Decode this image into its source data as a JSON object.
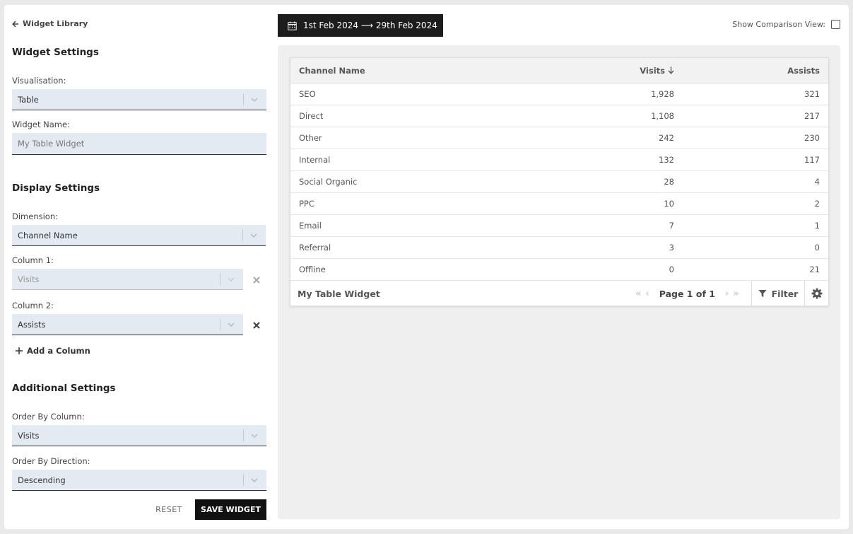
{
  "nav": {
    "back_label": "Widget Library"
  },
  "widget_settings": {
    "title": "Widget Settings",
    "visualisation_label": "Visualisation:",
    "visualisation_value": "Table",
    "name_label": "Widget Name:",
    "name_placeholder": "My Table Widget"
  },
  "display_settings": {
    "title": "Display Settings",
    "dimension_label": "Dimension:",
    "dimension_value": "Channel Name",
    "column1_label": "Column 1:",
    "column1_value": "Visits",
    "column2_label": "Column 2:",
    "column2_value": "Assists",
    "add_column_label": "Add a Column"
  },
  "additional_settings": {
    "title": "Additional Settings",
    "order_column_label": "Order By Column:",
    "order_column_value": "Visits",
    "order_direction_label": "Order By Direction:",
    "order_direction_value": "Descending"
  },
  "actions": {
    "reset_label": "RESET",
    "save_label": "SAVE WIDGET"
  },
  "date_range": {
    "label": "1st Feb 2024 ⟶ 29th Feb 2024"
  },
  "comparison": {
    "label": "Show Comparison View:",
    "checked": false
  },
  "table": {
    "headers": [
      "Channel Name",
      "Visits",
      "Assists"
    ],
    "sort_column": "Visits",
    "sort_direction": "descending",
    "rows": [
      [
        "SEO",
        "1,928",
        "321"
      ],
      [
        "Direct",
        "1,108",
        "217"
      ],
      [
        "Other",
        "242",
        "230"
      ],
      [
        "Internal",
        "132",
        "117"
      ],
      [
        "Social Organic",
        "28",
        "4"
      ],
      [
        "PPC",
        "10",
        "2"
      ],
      [
        "Email",
        "7",
        "1"
      ],
      [
        "Referral",
        "3",
        "0"
      ],
      [
        "Offline",
        "0",
        "21"
      ]
    ]
  },
  "widget_footer": {
    "name": "My Table Widget",
    "page_text": "Page 1 of 1",
    "filter_label": "Filter"
  },
  "icons": {
    "back": "arrow-left-icon",
    "calendar": "calendar-icon",
    "sort": "arrow-down-icon",
    "filter": "filter-icon",
    "gear": "gear-icon",
    "remove": "close-icon",
    "add": "plus-icon"
  }
}
